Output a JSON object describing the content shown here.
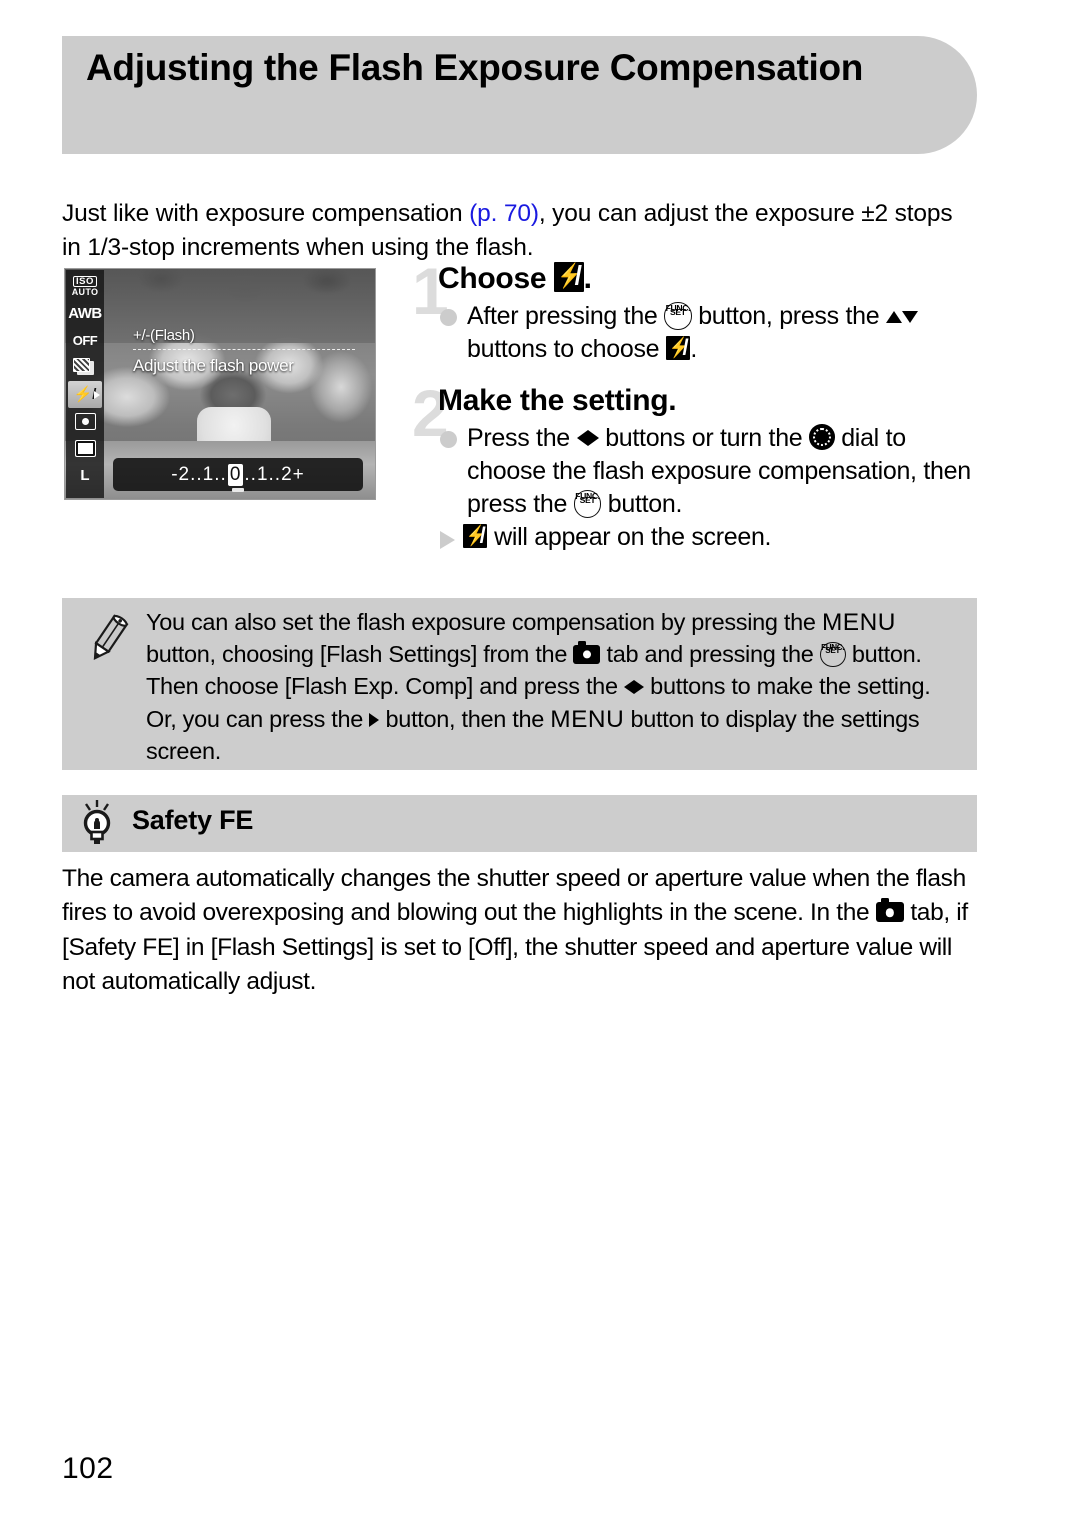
{
  "header": {
    "title": "Adjusting the Flash Exposure Compensation"
  },
  "intro": {
    "before_link": "Just like with exposure compensation ",
    "link": "(p. 70)",
    "after_link": ", you can adjust the exposure ±2 stops in 1/3-stop increments when using the flash."
  },
  "camera_screen": {
    "osd_items": [
      {
        "name": "iso-auto",
        "line1": "ISO",
        "line2": "AUTO"
      },
      {
        "name": "white-balance",
        "label": "AWB"
      },
      {
        "name": "my-colors-off",
        "label": "OFF"
      },
      {
        "name": "i-contrast",
        "label": ""
      },
      {
        "name": "flash-exposure-compensation",
        "label": "",
        "selected": true
      },
      {
        "name": "metering-mode",
        "label": ""
      },
      {
        "name": "drive-mode",
        "label": ""
      },
      {
        "name": "image-quality",
        "label": "L"
      }
    ],
    "overlay_title": "+/-(Flash)",
    "overlay_desc": "Adjust the flash power",
    "scale": {
      "left_label": "-2",
      "mid_left": "1",
      "center": "0",
      "mid_right": "1",
      "right_label": "2",
      "plus": "+",
      "dots": ".."
    }
  },
  "steps": [
    {
      "number": "1",
      "title_before": "Choose ",
      "title_icon": "flash-exposure-compensation-icon",
      "title_after": ".",
      "bullets": [
        {
          "marker": "dot",
          "parts": [
            {
              "t": "text",
              "v": "After pressing the "
            },
            {
              "t": "icon",
              "v": "func-set-button"
            },
            {
              "t": "text",
              "v": " button, press the "
            },
            {
              "t": "icon",
              "v": "up-button"
            },
            {
              "t": "icon",
              "v": "down-button"
            },
            {
              "t": "text",
              "v": " buttons to choose "
            },
            {
              "t": "icon",
              "v": "flash-exposure-compensation-icon"
            },
            {
              "t": "text",
              "v": "."
            }
          ]
        }
      ]
    },
    {
      "number": "2",
      "title_before": "Make the setting.",
      "title_icon": "",
      "title_after": "",
      "bullets": [
        {
          "marker": "dot",
          "parts": [
            {
              "t": "text",
              "v": "Press the "
            },
            {
              "t": "icon",
              "v": "left-button"
            },
            {
              "t": "icon",
              "v": "right-button"
            },
            {
              "t": "text",
              "v": " buttons or turn the "
            },
            {
              "t": "icon",
              "v": "control-dial"
            },
            {
              "t": "text",
              "v": " dial to choose the flash exposure compensation, then press the "
            },
            {
              "t": "icon",
              "v": "func-set-button"
            },
            {
              "t": "text",
              "v": " button."
            }
          ]
        },
        {
          "marker": "triangle",
          "parts": [
            {
              "t": "icon",
              "v": "flash-exposure-compensation-icon"
            },
            {
              "t": "text",
              "v": " will appear on the screen."
            }
          ]
        }
      ]
    }
  ],
  "note": {
    "icon": "pencil-icon",
    "segments": [
      {
        "t": "text",
        "v": "You can also set the flash exposure compensation by pressing the "
      },
      {
        "t": "menu",
        "v": "MENU"
      },
      {
        "t": "text",
        "v": " button, choosing [Flash Settings] from the "
      },
      {
        "t": "icon",
        "v": "camera-tab-icon"
      },
      {
        "t": "text",
        "v": " tab and pressing the "
      },
      {
        "t": "icon",
        "v": "func-set-button"
      },
      {
        "t": "text",
        "v": " button. Then choose [Flash Exp. Comp] and press the "
      },
      {
        "t": "icon",
        "v": "left-button"
      },
      {
        "t": "icon",
        "v": "right-button"
      },
      {
        "t": "text",
        "v": " buttons to make the setting. Or, you can press the "
      },
      {
        "t": "icon",
        "v": "right-button"
      },
      {
        "t": "text",
        "v": " button, then the "
      },
      {
        "t": "menu",
        "v": "MENU"
      },
      {
        "t": "text",
        "v": " button to display the settings screen."
      }
    ]
  },
  "safety_fe": {
    "icon": "light-bulb-icon",
    "title": "Safety FE",
    "segments": [
      {
        "t": "text",
        "v": "The camera automatically changes the shutter speed or aperture value when the flash fires to avoid overexposing and blowing out the highlights in the scene. In the "
      },
      {
        "t": "icon",
        "v": "camera-tab-icon"
      },
      {
        "t": "text",
        "v": " tab, if [Safety FE] in [Flash Settings] is set to [Off], the shutter speed and aperture value will not automatically adjust."
      }
    ]
  },
  "footer": {
    "page_number": "102"
  },
  "colors": {
    "header_gray": "#cccccc",
    "box_gray": "#cdcdcd",
    "link_blue": "#1a1ae0",
    "step_number_gray": "#dcdcdc",
    "bullet_gray": "#cccccc"
  }
}
